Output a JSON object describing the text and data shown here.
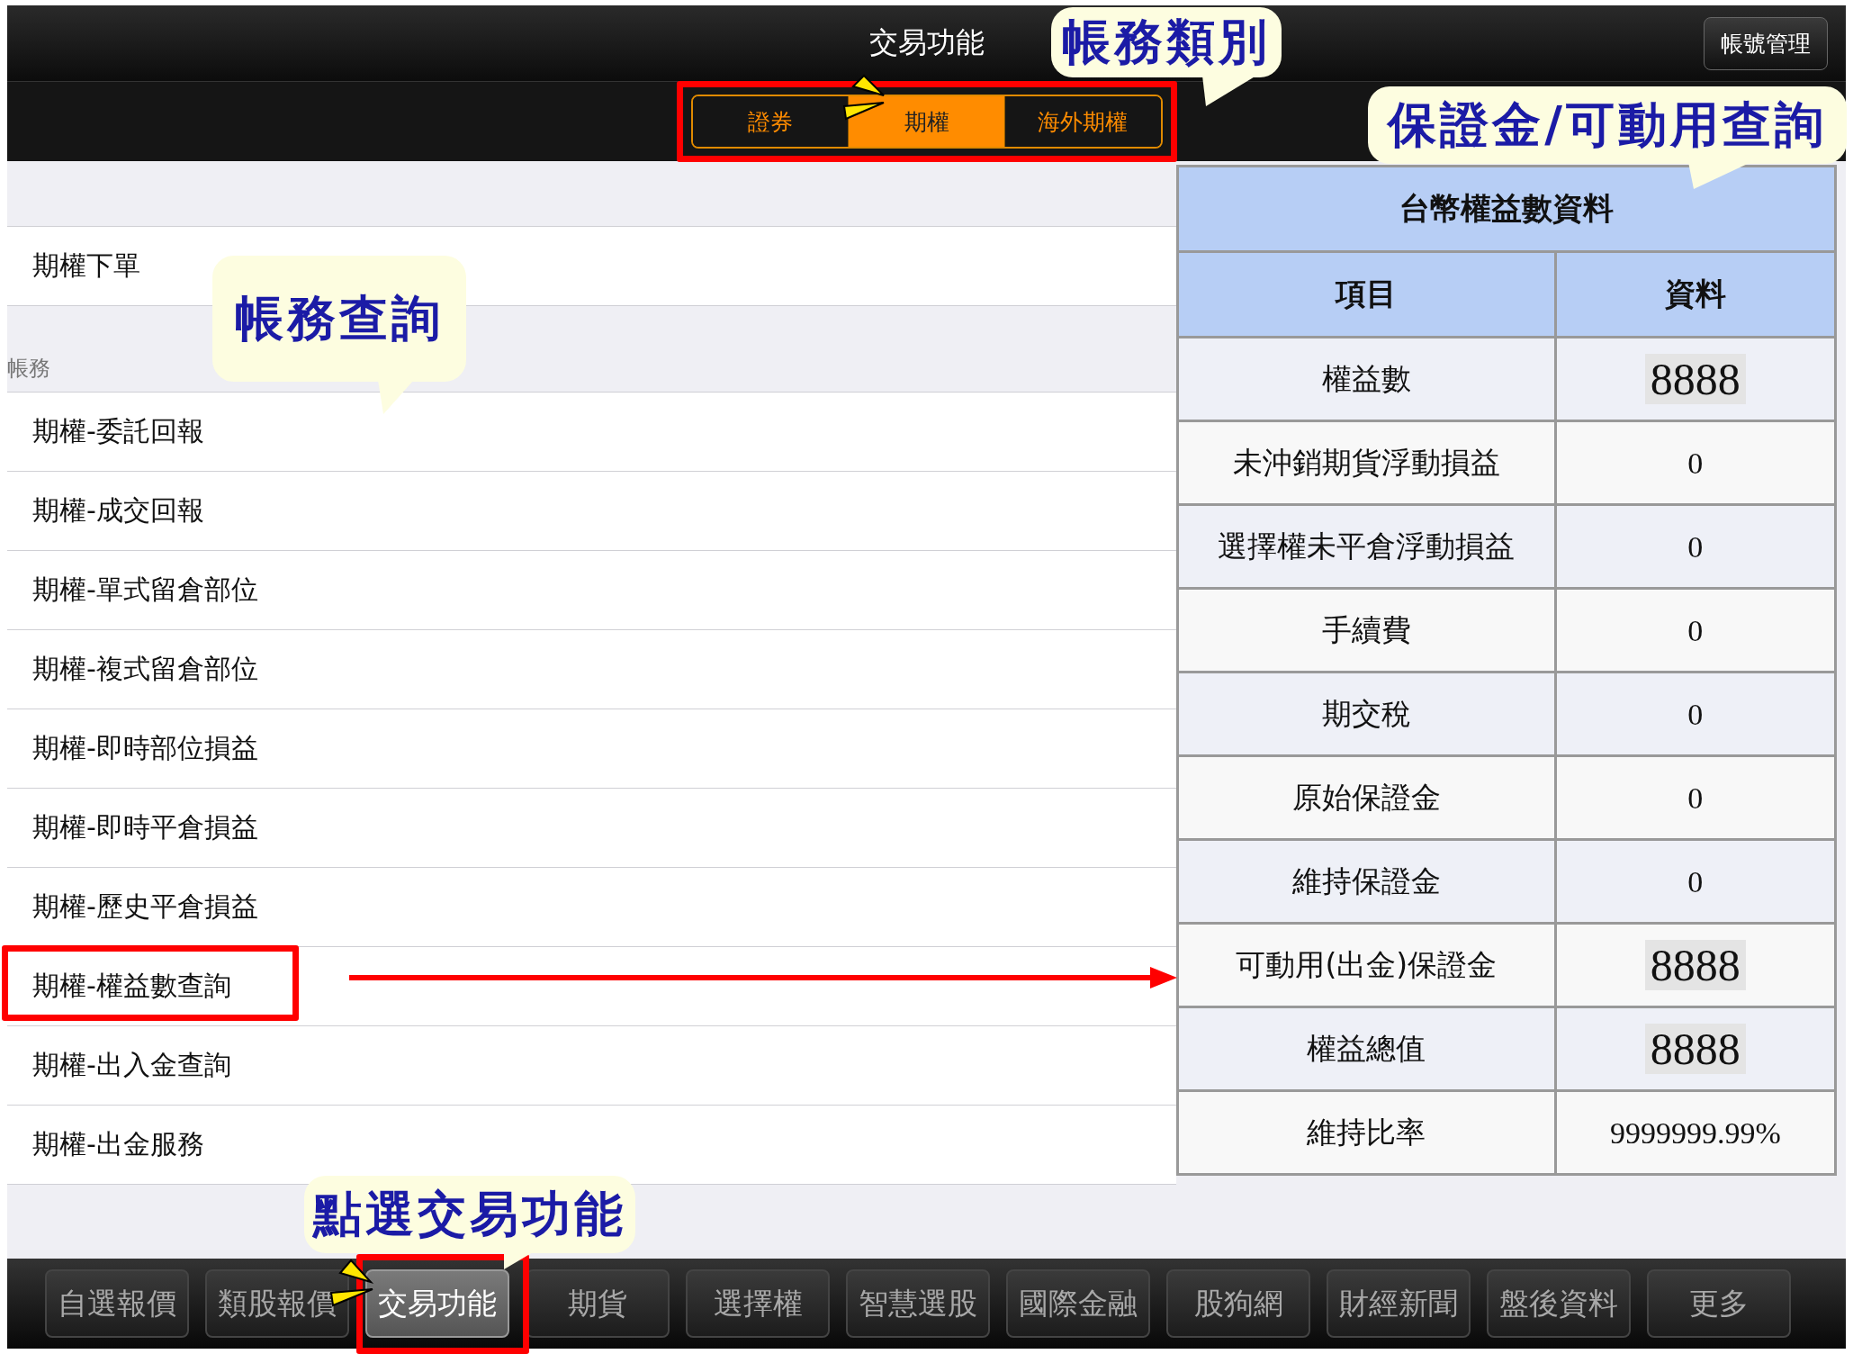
{
  "header": {
    "title": "交易功能",
    "account_button": "帳號管理"
  },
  "segments": [
    {
      "label": "證券",
      "selected": false
    },
    {
      "label": "期權",
      "selected": true
    },
    {
      "label": "海外期權",
      "selected": false
    }
  ],
  "menu": [
    {
      "kind": "item",
      "label": "期權下單"
    },
    {
      "kind": "section",
      "label": "帳務"
    },
    {
      "kind": "item",
      "label": "期權-委託回報"
    },
    {
      "kind": "item",
      "label": "期權-成交回報"
    },
    {
      "kind": "item",
      "label": "期權-單式留倉部位"
    },
    {
      "kind": "item",
      "label": "期權-複式留倉部位"
    },
    {
      "kind": "item",
      "label": "期權-即時部位損益"
    },
    {
      "kind": "item",
      "label": "期權-即時平倉損益"
    },
    {
      "kind": "item",
      "label": "期權-歷史平倉損益"
    },
    {
      "kind": "item",
      "label": "期權-權益數查詢"
    },
    {
      "kind": "item",
      "label": "期權-出入金查詢"
    },
    {
      "kind": "item",
      "label": "期權-出金服務"
    }
  ],
  "table": {
    "title": "台幣權益數資料",
    "columns": [
      "項目",
      "資料"
    ],
    "rows": [
      {
        "item": "權益數",
        "value": "8888",
        "highlighted": true
      },
      {
        "item": "未沖銷期貨浮動損益",
        "value": "0",
        "highlighted": false
      },
      {
        "item": "選擇權未平倉浮動損益",
        "value": "0",
        "highlighted": false
      },
      {
        "item": "手續費",
        "value": "0",
        "highlighted": false
      },
      {
        "item": "期交稅",
        "value": "0",
        "highlighted": false
      },
      {
        "item": "原始保證金",
        "value": "0",
        "highlighted": false
      },
      {
        "item": "維持保證金",
        "value": "0",
        "highlighted": false
      },
      {
        "item": "可動用(出金)保證金",
        "value": "8888",
        "highlighted": true
      },
      {
        "item": "權益總值",
        "value": "8888",
        "highlighted": true
      },
      {
        "item": "維持比率",
        "value": "9999999.99%",
        "highlighted": false
      }
    ]
  },
  "tab_bar": [
    {
      "label": "自選報價",
      "selected": false
    },
    {
      "label": "類股報價",
      "selected": false
    },
    {
      "label": "交易功能",
      "selected": true
    },
    {
      "label": "期貨",
      "selected": false
    },
    {
      "label": "選擇權",
      "selected": false
    },
    {
      "label": "智慧選股",
      "selected": false
    },
    {
      "label": "國際金融",
      "selected": false
    },
    {
      "label": "股狗網",
      "selected": false
    },
    {
      "label": "財經新聞",
      "selected": false
    },
    {
      "label": "盤後資料",
      "selected": false
    },
    {
      "label": "更多",
      "selected": false
    }
  ],
  "callouts": [
    {
      "text": "帳務類別"
    },
    {
      "text": "保證金/可動用查詢"
    },
    {
      "text": "帳務查詢"
    },
    {
      "text": "點選交易功能"
    }
  ]
}
